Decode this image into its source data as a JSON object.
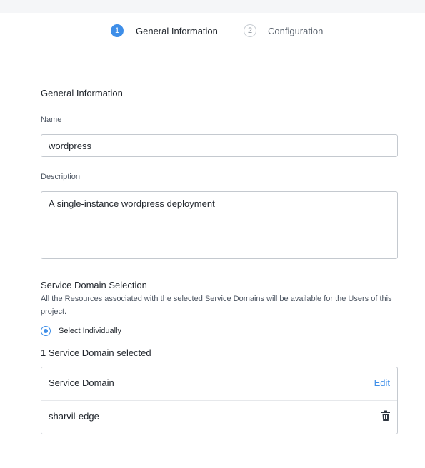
{
  "stepper": {
    "steps": [
      {
        "number": "1",
        "label": "General Information",
        "state": "active"
      },
      {
        "number": "2",
        "label": "Configuration",
        "state": "inactive"
      }
    ]
  },
  "form": {
    "section_title": "General Information",
    "name_label": "Name",
    "name_value": "wordpress",
    "description_label": "Description",
    "description_value": "A single-instance wordpress deployment"
  },
  "service_domain": {
    "title": "Service Domain Selection",
    "description": "All the Resources associated with the selected Service Domains will be available for the Users of this project.",
    "radio_label": "Select Individually",
    "radio_selected": true,
    "count_text": "1 Service Domain selected",
    "table": {
      "header": "Service Domain",
      "edit_label": "Edit",
      "rows": [
        {
          "name": "sharvil-edge",
          "action_icon": "trash-icon"
        }
      ]
    }
  },
  "colors": {
    "accent": "#3e8ee8",
    "border": "#c4c9cf",
    "text": "#22272e"
  }
}
